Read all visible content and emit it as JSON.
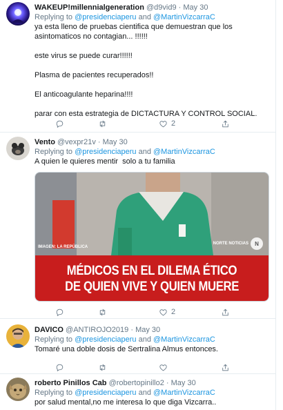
{
  "tweets": [
    {
      "name": "WAKEUP!millennialgeneration",
      "handle": "@d9vid9",
      "date": "May 30",
      "replying_prefix": "Replying to ",
      "mention1": "@presidenciaperu",
      "and": " and ",
      "mention2": "@MartinVizcarraC",
      "text": "ya esta lleno de pruebas cientifica que demuestran que los asintomaticos no contagian... !!!!!!\n\neste virus se puede curar!!!!!!\n\nPlasma de pacientes recuperados!!\n\nEl anticoagulante heparina!!!!\n\nparar con esta estrategia de DICTACTURA Y CONTROL SOCIAL.",
      "like_count": "2"
    },
    {
      "name": "Vento",
      "handle": "@vexpr21v",
      "date": "May 30",
      "replying_prefix": "Replying to ",
      "mention1": "@presidenciaperu",
      "and": " and ",
      "mention2": "@MartinVizcarraC",
      "text": "A quien le quieres mentir  solo a tu familia",
      "media": {
        "headline_line1": "MÉDICOS EN EL DILEMA ÉTICO",
        "headline_line2": "DE QUIEN VIVE Y QUIEN MUERE",
        "credit": "IMAGEN: LA REPÚBLICA",
        "logo": "NORTE NOTICIAS",
        "logo_mark": "N"
      },
      "like_count": "2"
    },
    {
      "name": "DAVICO",
      "handle": "@ANTIROJO2019",
      "date": "May 30",
      "replying_prefix": "Replying to ",
      "mention1": "@presidenciaperu",
      "and": " and ",
      "mention2": "@MartinVizcarraC",
      "text": "Tomaré una doble dosis de Sertralina Almus entonces."
    },
    {
      "name": "roberto Pinillos Cab",
      "handle": "@robertopinillo2",
      "date": "May 30",
      "replying_prefix": "Replying to ",
      "mention1": "@presidenciaperu",
      "and": " and ",
      "mention2": "@MartinVizcarraC",
      "text": "por salud mental,no me interesa lo que diga Vizcarra.."
    }
  ],
  "separator": "·",
  "icons": {
    "reply": "reply-icon",
    "retweet": "retweet-icon",
    "like": "heart-icon",
    "share": "share-icon"
  },
  "colors": {
    "link": "#1b95e0",
    "muted": "#657786",
    "banner": "#c81d1d"
  }
}
